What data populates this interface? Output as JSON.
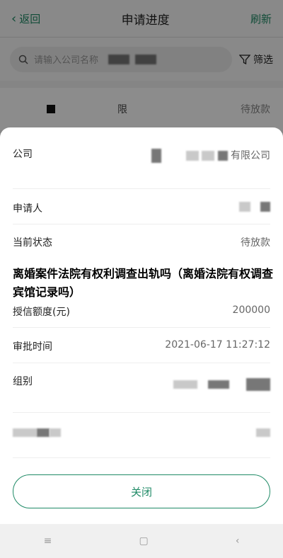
{
  "nav": {
    "back_label": "返回",
    "title": "申请进度",
    "refresh_label": "刷新"
  },
  "search": {
    "placeholder": "请输入公司名称",
    "filter_label": "筛选"
  },
  "bg_list": [
    {
      "name_suffix": "限",
      "status": "待放款"
    }
  ],
  "sheet": {
    "rows": [
      {
        "label": "公司",
        "value": "有限公司"
      },
      {
        "label": "申请人",
        "value": ""
      },
      {
        "label": "当前状态",
        "value": "待放款"
      },
      {
        "label": "授信额度(元)",
        "value": "200000"
      },
      {
        "label": "审批时间",
        "value": "2021-06-17 11:27:12"
      },
      {
        "label": "组别",
        "value": ""
      }
    ],
    "close_label": "关闭"
  },
  "overlay_caption": "离婚案件法院有权利调查出轨吗（离婚法院有权调查宾馆记录吗）",
  "colors": {
    "accent": "#1f8a66"
  },
  "sysnav": {
    "menu_icon": "menu-icon",
    "home_icon": "home-square-icon",
    "back_icon": "back-triangle-icon"
  }
}
